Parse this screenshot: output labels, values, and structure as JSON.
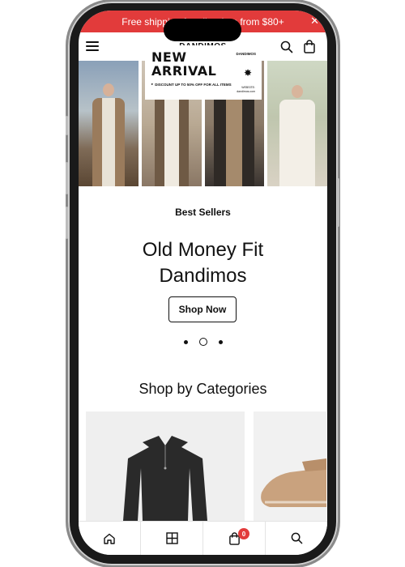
{
  "promo": {
    "text": "Free shipping for all orders from $80+",
    "close": "✕",
    "color": "#e23b3b"
  },
  "header": {
    "brand": "DANDIMOS",
    "icons": [
      "menu-icon",
      "search-icon",
      "bag-icon"
    ]
  },
  "hero": {
    "headline": "NEW\nARRIVAL",
    "discount": "DISCOUNT UP TO 50% OFF FOR ALL ITEMS",
    "mini_brand": "DANDIMOS",
    "star": "✸",
    "website_label": "WEBSITE:",
    "website_value": "dandimos.com"
  },
  "featured": {
    "eyebrow": "Best Sellers",
    "title_line1": "Old Money Fit",
    "title_line2": "Dandimos",
    "cta": "Shop Now",
    "slides": 3,
    "active_slide": 2
  },
  "categories": {
    "title": "Shop by Categories"
  },
  "bottom_nav": {
    "items": [
      "home-icon",
      "grid-icon",
      "bag-icon",
      "search-icon"
    ],
    "cart_count": "0"
  }
}
